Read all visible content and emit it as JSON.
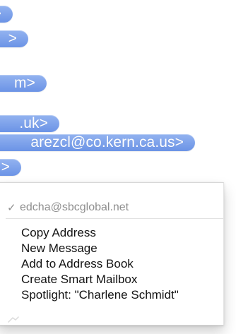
{
  "address_tokens": [
    {
      "label": ">"
    },
    {
      "label": ">"
    },
    {
      "label": "m>"
    },
    {
      "label": ".uk>"
    },
    {
      "label": "arezcl@co.kern.ca.us>"
    },
    {
      "label": ">"
    }
  ],
  "context_menu": {
    "header": {
      "checkmark": "✓",
      "email": "edcha@sbcglobal.net"
    },
    "items": [
      {
        "label": "Copy Address"
      },
      {
        "label": "New Message"
      },
      {
        "label": "Add to Address Book"
      },
      {
        "label": "Create Smart Mailbox"
      },
      {
        "label": "Spotlight: \"Charlene Schmidt\""
      }
    ]
  }
}
